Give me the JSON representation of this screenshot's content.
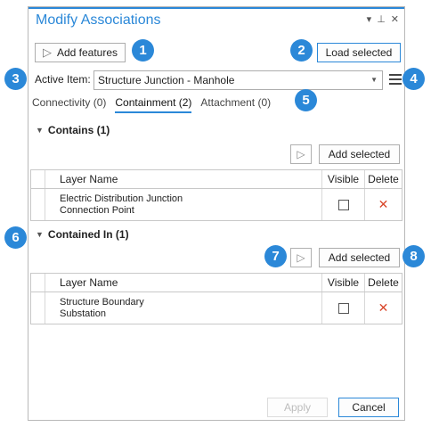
{
  "pane": {
    "title": "Modify Associations",
    "controls": [
      "▾",
      "⊥",
      "✕"
    ]
  },
  "toolbar": {
    "add_features_label": "Add features",
    "load_selected_label": "Load selected"
  },
  "active_item": {
    "label": "Active Item:",
    "value": "Structure Junction - Manhole"
  },
  "tabs": [
    {
      "label": "Connectivity (0)",
      "active": false
    },
    {
      "label": "Containment (2)",
      "active": true
    },
    {
      "label": "Attachment (0)",
      "active": false
    }
  ],
  "contains": {
    "title": "Contains (1)",
    "add_selected_label": "Add selected",
    "columns": [
      "Layer Name",
      "Visible",
      "Delete"
    ],
    "rows": [
      {
        "name_line1": "Electric Distribution Junction",
        "name_line2": "Connection Point",
        "visible": false
      }
    ]
  },
  "contained_in": {
    "title": "Contained In (1)",
    "add_selected_label": "Add selected",
    "columns": [
      "Layer Name",
      "Visible",
      "Delete"
    ],
    "rows": [
      {
        "name_line1": "Structure Boundary",
        "name_line2": "Substation",
        "visible": false
      }
    ]
  },
  "footer": {
    "apply_label": "Apply",
    "cancel_label": "Cancel"
  },
  "callouts": [
    "1",
    "2",
    "3",
    "4",
    "5",
    "6",
    "7",
    "8"
  ],
  "colors": {
    "accent": "#2b88d8",
    "delete": "#d9472b"
  }
}
